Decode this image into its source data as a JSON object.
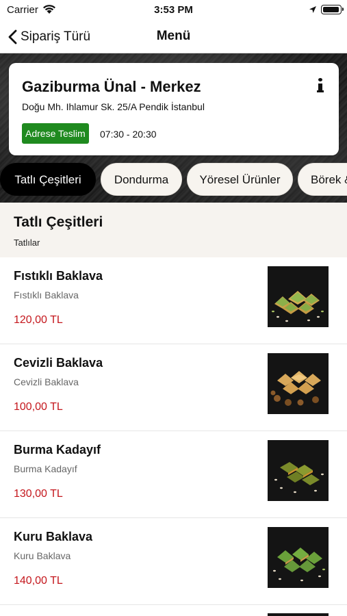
{
  "status_bar": {
    "carrier": "Carrier",
    "time": "3:53 PM"
  },
  "nav": {
    "back_label": "Sipariş Türü",
    "title": "Menü"
  },
  "restaurant": {
    "name": "Gaziburma Ünal - Merkez",
    "address": "Doğu Mh. Ihlamur Sk. 25/A Pendik İstanbul",
    "delivery_badge": "Adrese Teslim",
    "hours": "07:30 - 20:30",
    "badge_color": "#1f8a1f"
  },
  "tabs": [
    {
      "label": "Tatlı Çeşitleri",
      "active": true
    },
    {
      "label": "Dondurma",
      "active": false
    },
    {
      "label": "Yöresel Ürünler",
      "active": false
    },
    {
      "label": "Börek &",
      "active": false
    }
  ],
  "section": {
    "title": "Tatlı Çeşitleri",
    "subtitle": "Tatlılar"
  },
  "products": [
    {
      "name": "Fıstıklı Baklava",
      "description": "Fıstıklı Baklava",
      "price": "120,00 TL",
      "image": "pistachio-baklava-photo"
    },
    {
      "name": "Cevizli Baklava",
      "description": "Cevizli Baklava",
      "price": "100,00 TL",
      "image": "walnut-baklava-photo"
    },
    {
      "name": "Burma Kadayıf",
      "description": "Burma Kadayıf",
      "price": "130,00 TL",
      "image": "burma-kadayif-photo"
    },
    {
      "name": "Kuru Baklava",
      "description": "Kuru Baklava",
      "price": "140,00 TL",
      "image": "dry-baklava-photo"
    }
  ],
  "colors": {
    "price": "#c4161c",
    "active_tab": "#000000",
    "tab_bg": "#f7f4ef",
    "section_bg": "#f6f3ef"
  }
}
